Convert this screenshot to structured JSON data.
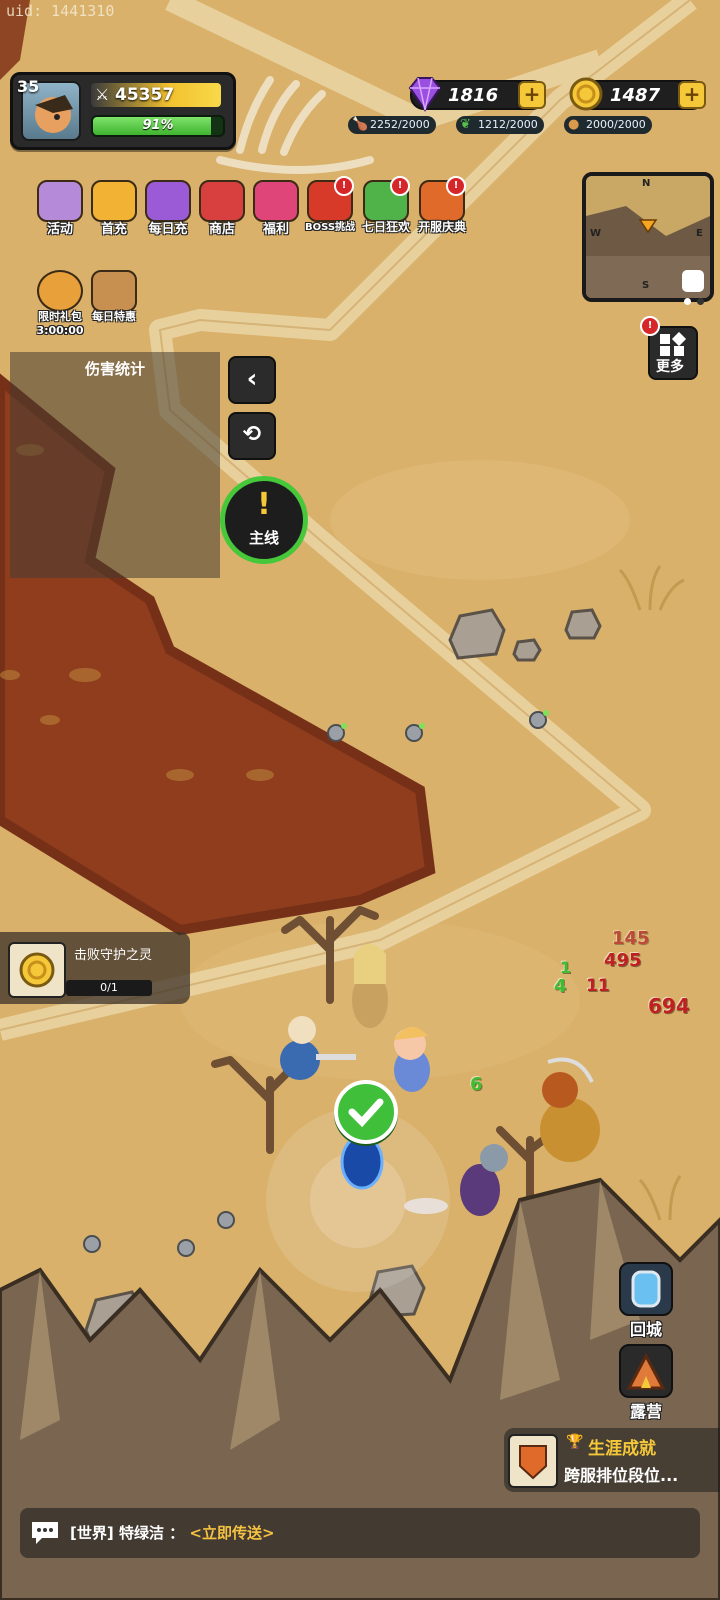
{
  "uid": "uid: 1441310",
  "player": {
    "level": "35",
    "power": "45357",
    "exp_text": "91%",
    "exp_fraction": 0.91
  },
  "currency": {
    "gems": "1816",
    "gold": "1487"
  },
  "resources": [
    {
      "name": "meat-icon",
      "value": "2252/2000"
    },
    {
      "name": "leaf-icon",
      "value": "1212/2000"
    },
    {
      "name": "bread-icon",
      "value": "2000/2000"
    }
  ],
  "menu": [
    {
      "key": "activity",
      "label": "活动",
      "color": "#b58ad8",
      "badge": false
    },
    {
      "key": "first-recharge",
      "label": "首充",
      "color": "#f2b233",
      "badge": false
    },
    {
      "key": "daily-recharge",
      "label": "每日充",
      "color": "#9b5bd6",
      "badge": false
    },
    {
      "key": "shop",
      "label": "商店",
      "color": "#d84040",
      "badge": false
    },
    {
      "key": "welfare",
      "label": "福利",
      "color": "#e0457a",
      "badge": false
    },
    {
      "key": "boss-challenge",
      "label": "BOSS挑战",
      "color": "#d83a2a",
      "badge": true
    },
    {
      "key": "seven-day",
      "label": "七日狂欢",
      "color": "#4fb34a",
      "badge": true
    },
    {
      "key": "server-celebration",
      "label": "开服庆典",
      "color": "#e06a2a",
      "badge": true
    }
  ],
  "menu2": [
    {
      "key": "limited-pack",
      "label": "限时礼包",
      "sub": "3:00:00",
      "color": "#e8a03a"
    },
    {
      "key": "daily-deal",
      "label": "每日特惠",
      "color": "#c89050"
    }
  ],
  "minimap": {
    "n": "N",
    "s": "S",
    "w": "W",
    "e": "E"
  },
  "more_label": "更多",
  "more_badge": "!",
  "damage_panel": {
    "title": "伤害统计"
  },
  "quest_main": {
    "label": "主线",
    "mark": "!"
  },
  "objective": {
    "text": "击败守护之灵",
    "progress": "0/1"
  },
  "damage_numbers": [
    {
      "text": "145",
      "color": "#b02020"
    },
    {
      "text": "495",
      "color": "#c02020"
    },
    {
      "text": "694",
      "color": "#c02020"
    },
    {
      "text": "11",
      "color": "#c02020"
    },
    {
      "text": "4",
      "color": "#3fbf2f"
    },
    {
      "text": "1",
      "color": "#3fbf2f"
    },
    {
      "text": "6",
      "color": "#3fbf2f"
    }
  ],
  "side_buttons": {
    "town": "回城",
    "camp": "露营"
  },
  "achievement": {
    "title": "生涯成就",
    "text": "跨服排位段位..."
  },
  "chat": {
    "channel": "[世界]",
    "sender": "特绿洁 ：",
    "link": "<立即传送>"
  },
  "colors": {
    "accent_green": "#46c83a",
    "gold": "#f5c83a",
    "gem": "#9b4fe0"
  }
}
